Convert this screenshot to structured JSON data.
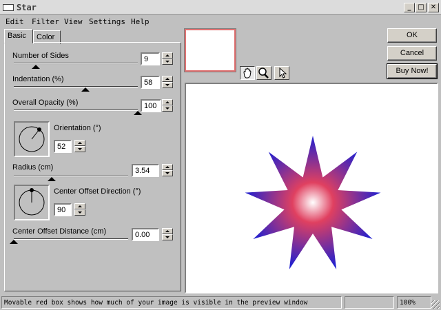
{
  "window": {
    "title": "Star",
    "minimize": "_",
    "maximize": "□",
    "close": "✕"
  },
  "menu": [
    "Edit",
    "Filter",
    "View",
    "Settings",
    "Help"
  ],
  "tabs": {
    "basic": "Basic",
    "color": "Color"
  },
  "controls": {
    "sides": {
      "label": "Number of Sides",
      "value": "9",
      "level": 0.18
    },
    "indentation": {
      "label": "Indentation (%)",
      "value": "58",
      "level": 0.58
    },
    "opacity": {
      "label": "Overall Opacity (%)",
      "value": "100",
      "level": 1.0
    },
    "orientation": {
      "label": "Orientation (°)",
      "value": "52"
    },
    "radius": {
      "label": "Radius (cm)",
      "value": "3.54",
      "level": 0.33
    },
    "offset_direction": {
      "label": "Center Offset Direction (°)",
      "value": "90"
    },
    "offset_distance": {
      "label": "Center Offset Distance (cm)",
      "value": "0.00",
      "level": 0.0
    }
  },
  "tools": [
    "hand-icon",
    "zoom-icon",
    "arrow-icon"
  ],
  "buttons": {
    "ok": "OK",
    "cancel": "Cancel",
    "buy": "Buy Now!"
  },
  "status": {
    "message": "Movable red box shows how much of your image is visible in the preview window",
    "zoom": "100%"
  },
  "colors": {
    "star_outer": "#2020d0",
    "star_mid": "#e04060",
    "star_center": "#ffffff",
    "preview_box": "#e07070"
  }
}
